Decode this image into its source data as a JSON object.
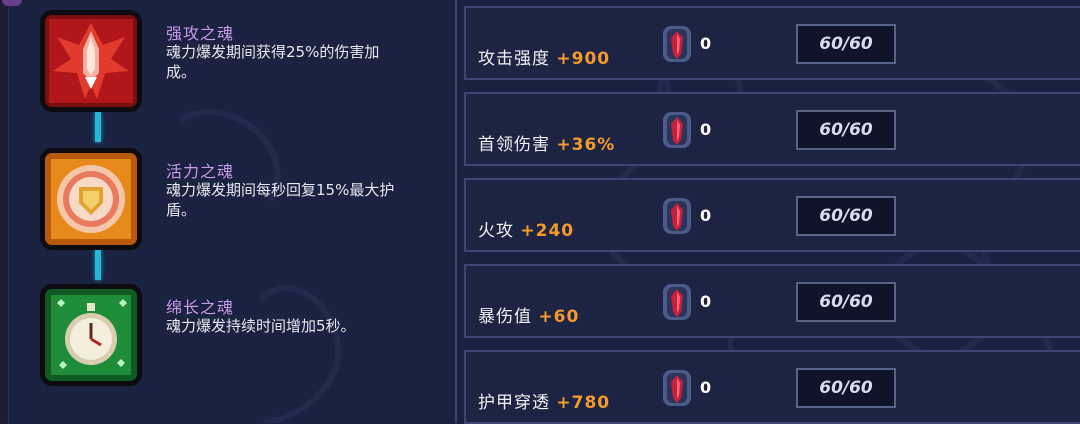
{
  "souls": [
    {
      "id": "power",
      "title": "强攻之魂",
      "desc_lines": [
        "魂力爆发期间获得25%的伤害加",
        "成。"
      ],
      "icon": "red-flame-icon",
      "color": "#c8231e"
    },
    {
      "id": "vitality",
      "title": "活力之魂",
      "desc_lines": [
        "魂力爆发期间每秒回复15%最大护",
        "盾。"
      ],
      "icon": "orange-shield-icon",
      "color": "#e07a1a"
    },
    {
      "id": "endurance",
      "title": "绵长之魂",
      "desc_lines": [
        "魂力爆发持续时间增加5秒。"
      ],
      "icon": "green-stopwatch-icon",
      "color": "#1f9a3a"
    }
  ],
  "stats": [
    {
      "label": "攻击强度",
      "bonus": "+900",
      "count": "0",
      "cap": "60/60"
    },
    {
      "label": "首领伤害",
      "bonus": "+36%",
      "count": "0",
      "cap": "60/60"
    },
    {
      "label": "火攻",
      "bonus": "+240",
      "count": "0",
      "cap": "60/60"
    },
    {
      "label": "暴伤值",
      "bonus": "+60",
      "count": "0",
      "cap": "60/60"
    },
    {
      "label": "护甲穿透",
      "bonus": "+780",
      "count": "0",
      "cap": "60/60"
    }
  ],
  "colors": {
    "background": "#1b2140",
    "soul_title": "#c59be6",
    "bonus": "#f39a2c",
    "connector": "#27b7d6",
    "row_border": "#3b4674"
  },
  "gem_icon": "soul-gem-icon"
}
